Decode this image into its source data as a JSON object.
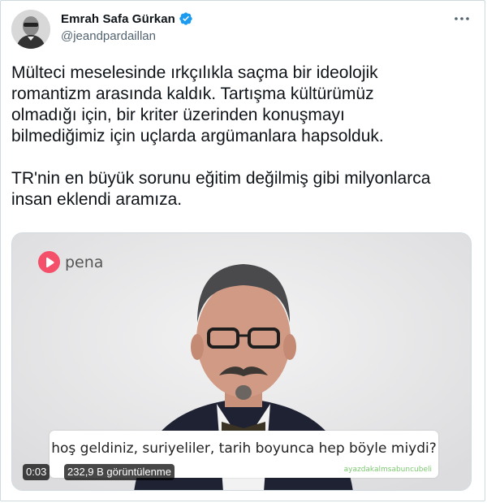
{
  "author": {
    "name": "Emrah Safa Gürkan",
    "handle": "@jeandpardaillan",
    "verified": true,
    "avatar_icon": "avatar-photo"
  },
  "more_icon": "more-options-icon",
  "tweet": {
    "paragraph1": "Mülteci meselesinde ırkçılıkla saçma bir ideolojik\nromantizm arasında kaldık. Tartışma kültürümüz\nolmadığı için, bir kriter üzerinden konuşmayı\nbilmediğimiz için uçlarda argümanlara hapsolduk.",
    "paragraph2": "TR'nin en büyük sorunu eğitim değilmiş gibi milyonlarca\ninsan eklendi aramıza."
  },
  "video": {
    "logo_text": "pena",
    "subtitle": "hoş geldiniz, suriyeliler, tarih boyunca hep böyle miydi?",
    "watermark": "ayazdakalmsabuncubeli",
    "elapsed": "0:03",
    "views": "232,9 B görüntülenme"
  },
  "colors": {
    "verified_blue": "#1d9bf0",
    "logo_red": "#f4506a",
    "muted_text": "#536471"
  }
}
